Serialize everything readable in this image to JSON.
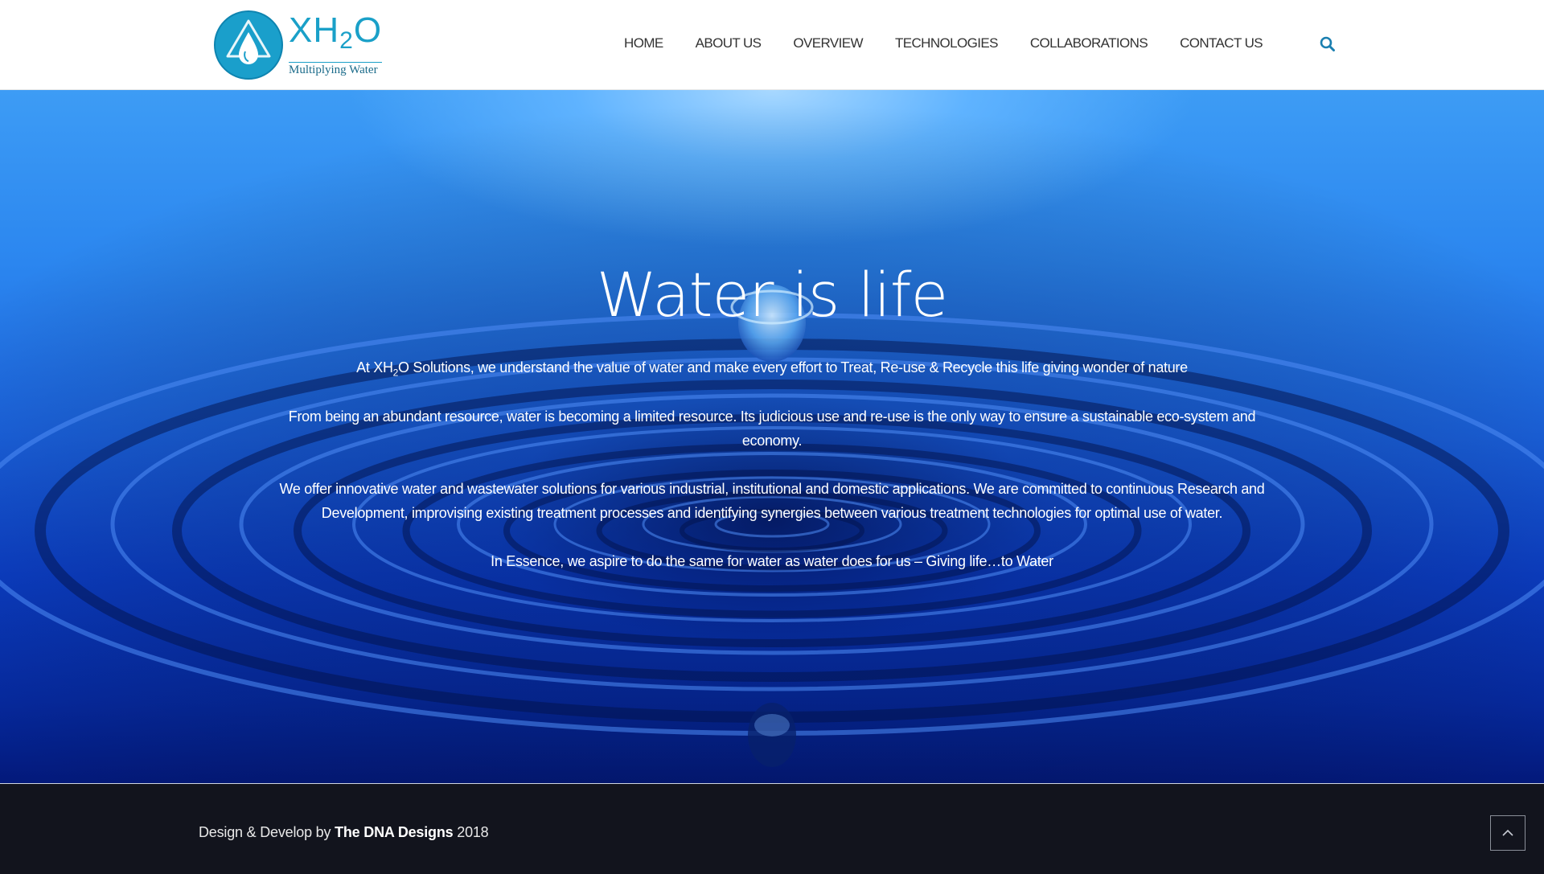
{
  "brand": {
    "name_prefix": "XH",
    "name_sub": "2",
    "name_suffix": "O",
    "tagline": "Multiplying Water",
    "accent": "#1aa0c8"
  },
  "nav": {
    "items": [
      "HOME",
      "ABOUT US",
      "OVERVIEW",
      "TECHNOLOGIES",
      "COLLABORATIONS",
      "CONTACT US"
    ],
    "search_icon": "search-icon"
  },
  "hero": {
    "title": "Water is life",
    "p1_before": "At XH",
    "p1_sub": "2",
    "p1_after": "O Solutions, we understand the value of water and make every effort to Treat, Re-use & Recycle this life giving wonder of nature",
    "p2": "From being an abundant resource, water is becoming a limited resource. Its judicious use and re-use is the only way to ensure a sustainable eco-system and economy.",
    "p3": "We offer innovative water and wastewater solutions for various industrial, institutional and domestic applications. We are committed to continuous Research and Development, improvising existing treatment processes and identifying synergies between various treatment technologies for optimal use of water.",
    "p4": "In Essence, we aspire to do the same for water as water does for us – Giving life…to Water"
  },
  "footer": {
    "prefix": "Design & Develop by ",
    "company": "The DNA Designs",
    "year": " 2018",
    "back_to_top_icon": "chevron-up-icon"
  }
}
